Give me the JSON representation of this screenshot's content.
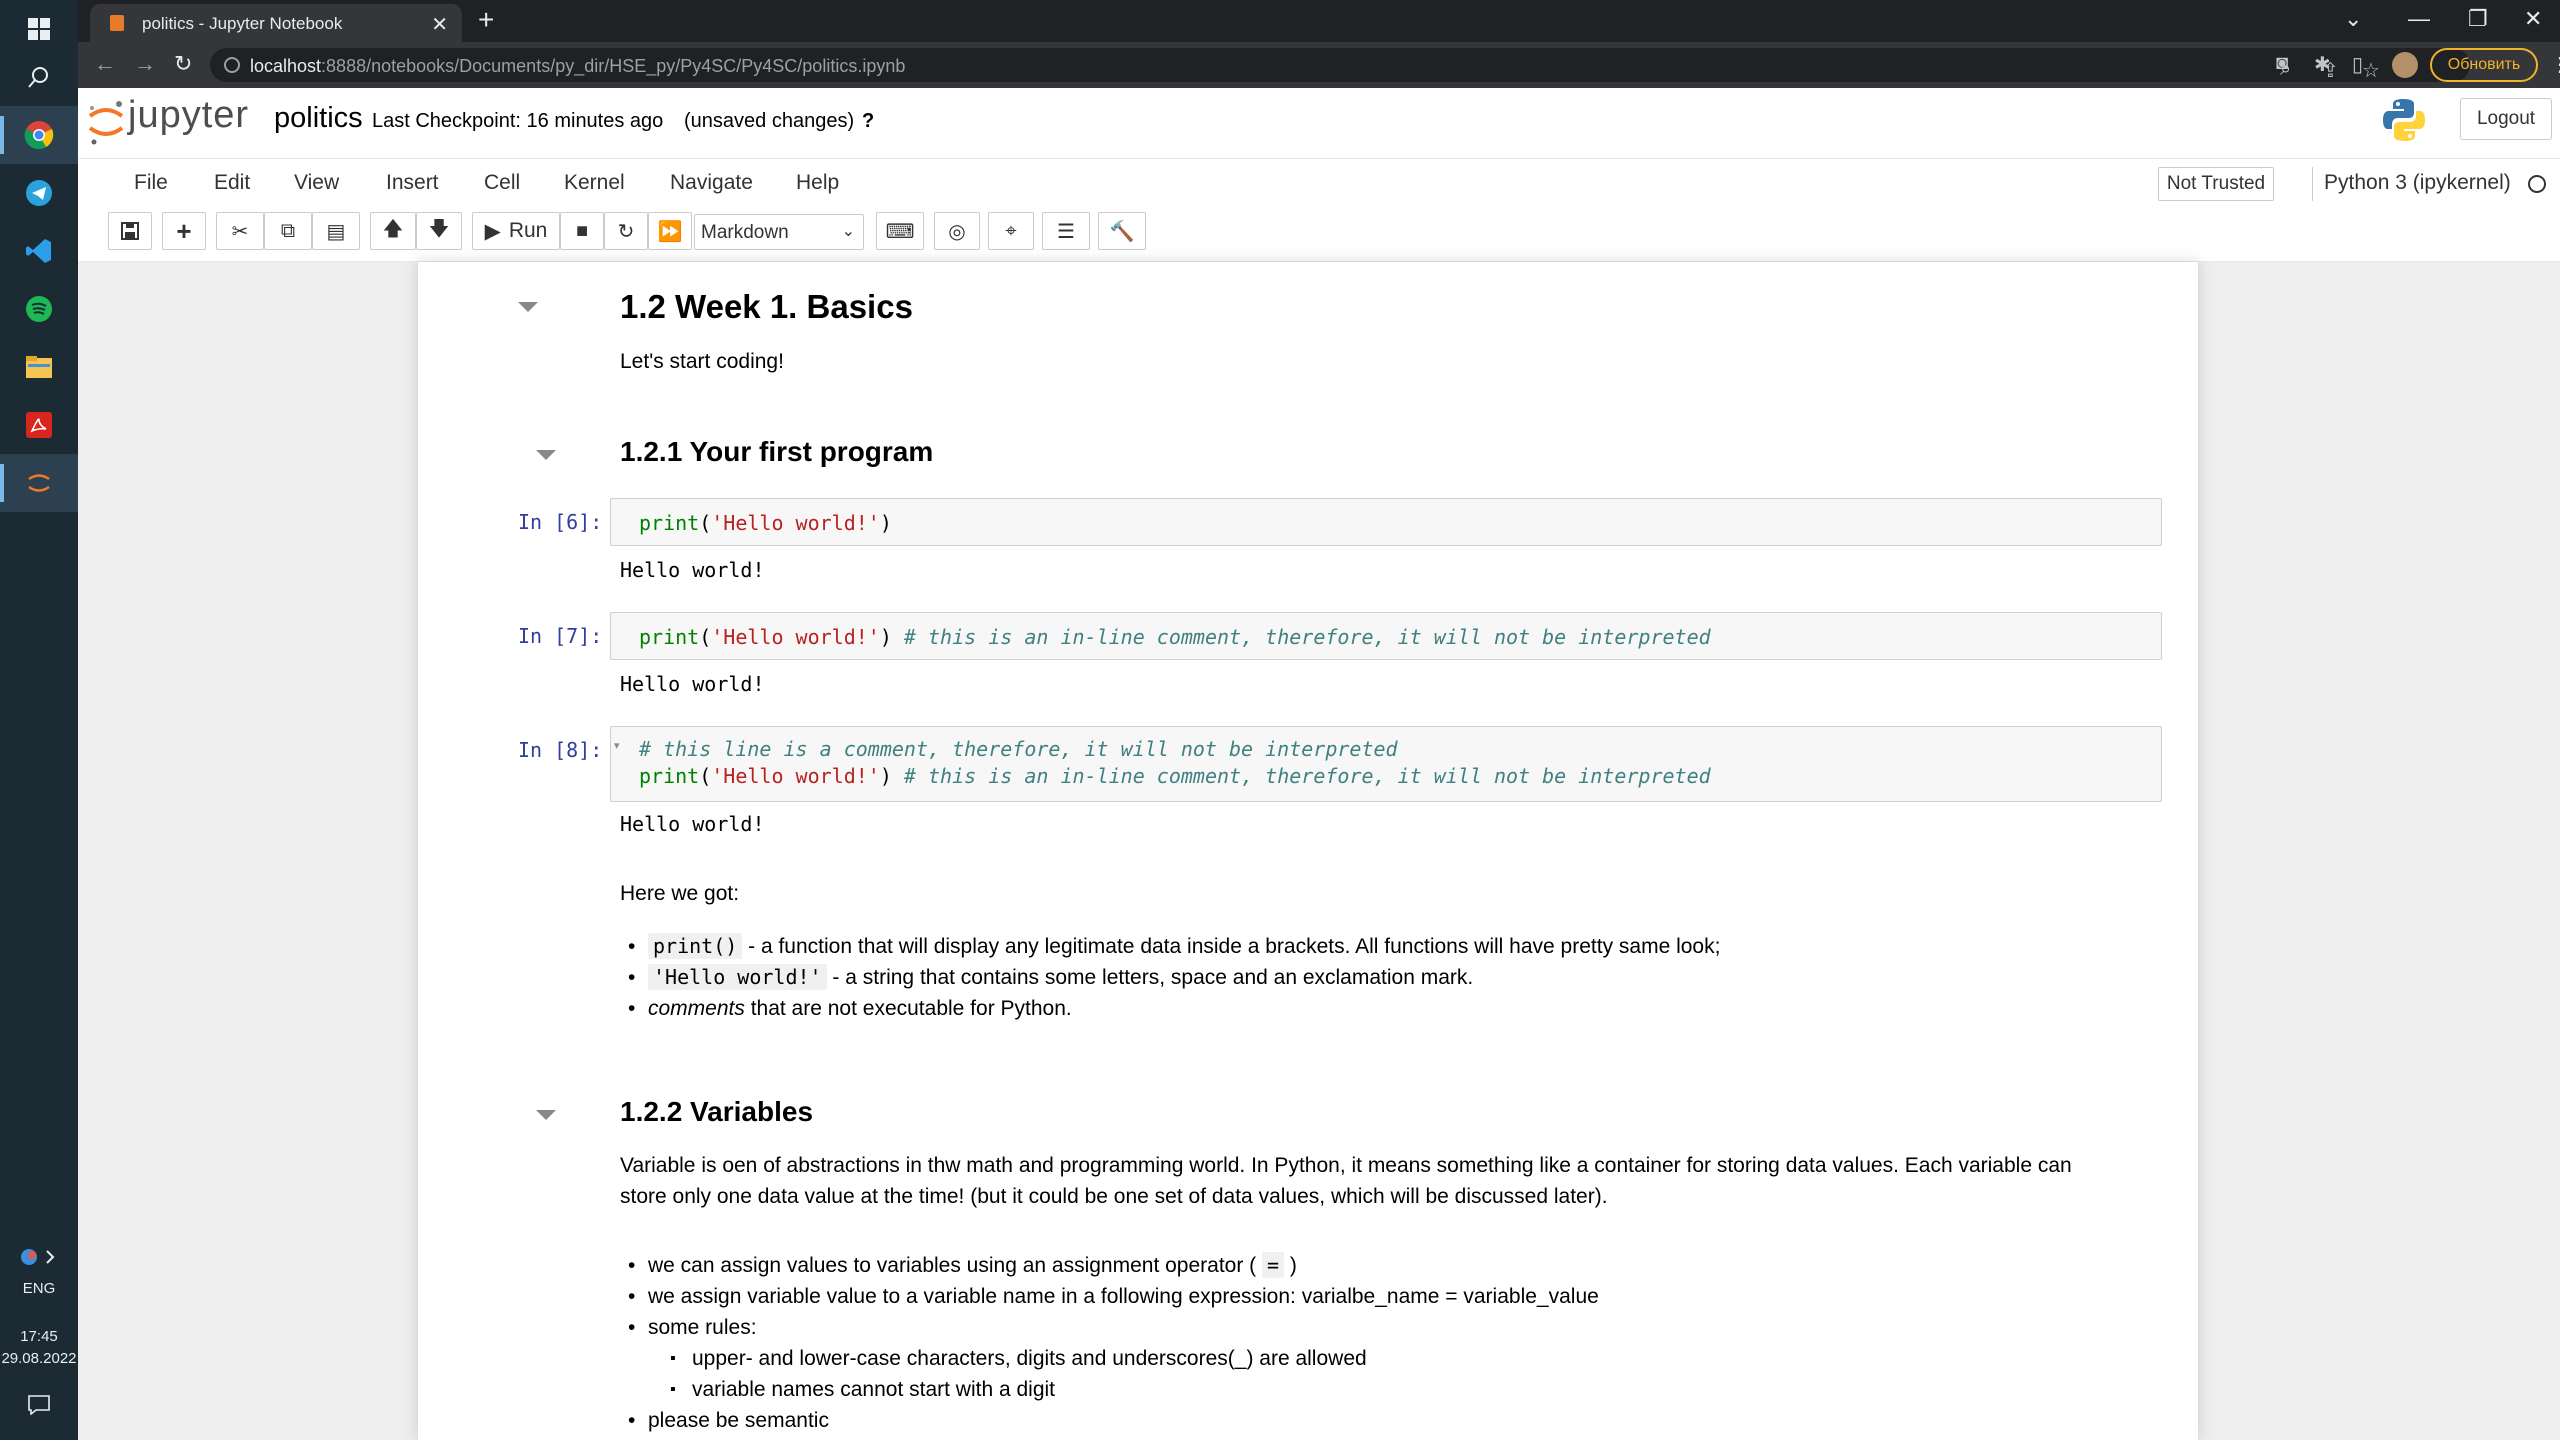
{
  "taskbar": {
    "language": "ENG",
    "time": "17:45",
    "date": "29.08.2022",
    "apps": [
      "start-icon",
      "search-icon",
      "chrome-icon",
      "telegram-icon",
      "vscode-icon",
      "spotify-icon",
      "file-explorer-icon",
      "acrobat-icon",
      "jupyter-taskbar-icon"
    ]
  },
  "browser": {
    "tab_title": "politics - Jupyter Notebook",
    "tab_close": "✕",
    "new_tab": "+",
    "url_host": "localhost",
    "url_path": ":8888/notebooks/Documents/py_dir/HSE_py/Py4SC/Py4SC/politics.ipynb",
    "update_button": "Обновить",
    "colors": {
      "tabstrip": "#202124",
      "toolbar": "#35363a",
      "update_accent": "#f0b429"
    }
  },
  "jupyter": {
    "brand": "jupyter",
    "notebook_name": "politics",
    "checkpoint": "Last Checkpoint: 16 minutes ago",
    "unsaved": "(unsaved changes)",
    "help_mark": "?",
    "logout": "Logout",
    "menu": [
      "File",
      "Edit",
      "View",
      "Insert",
      "Cell",
      "Kernel",
      "Navigate",
      "Help"
    ],
    "trust_status": "Not Trusted",
    "kernel": "Python 3 (ipykernel)",
    "toolbar": {
      "run_label": "Run",
      "cell_type": "Markdown"
    },
    "colors": {
      "prompt": "#303f9f",
      "string": "#ba2121",
      "builtin": "#008000",
      "comment": "#408080"
    }
  },
  "notebook": {
    "h_week": "1.2  Week 1. Basics",
    "intro": "Let's start coding!",
    "h_first": "1.2.1  Your first program",
    "cells": [
      {
        "prompt": "In [6]:",
        "lines": [
          {
            "fn": "print",
            "open": "(",
            "str": "'Hello world!'",
            "close": ")",
            "comment": ""
          }
        ],
        "output": "Hello world!"
      },
      {
        "prompt": "In [7]:",
        "lines": [
          {
            "fn": "print",
            "open": "(",
            "str": "'Hello world!'",
            "close": ")",
            "comment": " # this is an in-line comment, therefore, it will not be interpreted"
          }
        ],
        "output": "Hello world!"
      },
      {
        "prompt": "In [8]:",
        "comment_line": "# this line is a comment, therefore, it will not be interpreted",
        "lines": [
          {
            "fn": "print",
            "open": "(",
            "str": "'Hello world!'",
            "close": ")",
            "comment": " # this is an in-line comment, therefore, it will not be interpreted"
          }
        ],
        "output": "Hello world!"
      }
    ],
    "got_heading": "Here we got:",
    "got_items": [
      {
        "code": "print()",
        "text": " - a function that will display any legitimate data inside a brackets. All functions will have pretty same look;"
      },
      {
        "code": "'Hello world!'",
        "text": " - a string that contains some letters, space and an exclamation mark."
      },
      {
        "em": "comments",
        "text": " that are not executable for Python."
      }
    ],
    "h_vars": "1.2.2  Variables",
    "vars_para_1": "Variable is oen of abstractions in thw math and programming world. In Python, it means something like a container for storing data values. Each variable can",
    "vars_para_2": "store only one data value at the time! (but it could be one set of data values, which will be discussed later).",
    "vars_items": {
      "assign_pre": "we can assign values to variables using an assignment operator (",
      "assign_op": "=",
      "assign_post": ")",
      "expr": "we assign variable value to a variable name in a following expression: varialbe_name = variable_value",
      "rules": "some rules:",
      "rule_1": "upper- and lower-case characters, digits and underscores(_) are allowed",
      "rule_2": "variable names cannot start with a digit",
      "semantic": "please be semantic"
    }
  }
}
